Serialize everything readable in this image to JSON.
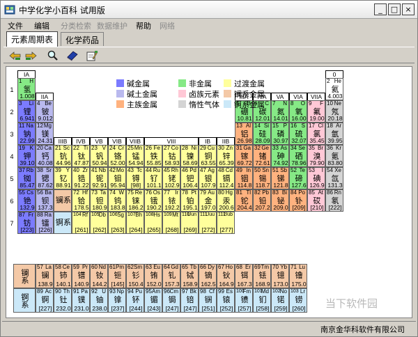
{
  "window": {
    "title": "中学化学小百科 试用版",
    "minimize": "_",
    "maximize": "□",
    "close": "×"
  },
  "menu": [
    {
      "label": "文件",
      "disabled": false
    },
    {
      "label": "编辑",
      "disabled": false
    },
    {
      "label": "分类检索",
      "disabled": true
    },
    {
      "label": "数据维护",
      "disabled": true
    },
    {
      "label": "帮助",
      "disabled": false
    },
    {
      "label": "网络",
      "disabled": true
    }
  ],
  "tabs": [
    {
      "label": "元素周期表",
      "active": true
    },
    {
      "label": "化学药品",
      "active": false
    }
  ],
  "toolbar_icons": [
    "back-forward-icon",
    "forward-icon",
    "search-icon",
    "book-icon",
    "edit-icon"
  ],
  "colors": {
    "alkali": "#7b7bff",
    "alkaline": "#b9b9ee",
    "main": "#ffb27f",
    "nonmetal": "#86e986",
    "halogen": "#ffc8d6",
    "noble": "#d4d4d4",
    "transition": "#ffff9c",
    "lanthanide": "#f4c9a7",
    "actinide": "#cbe8f8"
  },
  "legend": [
    {
      "key": "alkali",
      "label": "碱金属"
    },
    {
      "key": "nonmetal",
      "label": "非金属"
    },
    {
      "key": "transition",
      "label": "过渡金属"
    },
    {
      "key": "alkaline",
      "label": "碱土金属"
    },
    {
      "key": "halogen",
      "label": "卤族元素"
    },
    {
      "key": "lanthanide",
      "label": "镧系金属"
    },
    {
      "key": "main",
      "label": "主族金属"
    },
    {
      "key": "noble",
      "label": "惰性气体"
    },
    {
      "key": "actinide",
      "label": "锕系金属"
    }
  ],
  "group_headers": [
    "IA",
    "IIA",
    "IIIB",
    "IVB",
    "VB",
    "VIB",
    "VIIB",
    "VIII",
    "IB",
    "IIB",
    "IIIA",
    "IVA",
    "VA",
    "VIA",
    "VIIA",
    "0"
  ],
  "periods": [
    "1",
    "2",
    "3",
    "4",
    "5",
    "6",
    "7"
  ],
  "series_labels": {
    "lanthanide_block": "镧系",
    "actinide_block": "锕系",
    "lanthanide_row": "镧系",
    "actinide_row": "锕系"
  },
  "elements": [
    {
      "n": "1",
      "s": "H",
      "cn": "氢",
      "m": "1.008",
      "c": "nonmetal"
    },
    {
      "n": "2",
      "s": "He",
      "cn": "氦",
      "m": "4.003",
      "c": "white"
    },
    {
      "n": "3",
      "s": "Li",
      "cn": "锂",
      "m": "6.941",
      "c": "alkali"
    },
    {
      "n": "4",
      "s": "Be",
      "cn": "铍",
      "m": "9.012",
      "c": "alkaline"
    },
    {
      "n": "5",
      "s": "B",
      "cn": "硼",
      "m": "10.81",
      "c": "nonmetal"
    },
    {
      "n": "6",
      "s": "C",
      "cn": "碳",
      "m": "12.01",
      "c": "nonmetal"
    },
    {
      "n": "7",
      "s": "N",
      "cn": "氮",
      "m": "14.01",
      "c": "nonmetal"
    },
    {
      "n": "8",
      "s": "O",
      "cn": "氧",
      "m": "16.00",
      "c": "nonmetal"
    },
    {
      "n": "9",
      "s": "F",
      "cn": "氟",
      "m": "19.00",
      "c": "halogen"
    },
    {
      "n": "10",
      "s": "Ne",
      "cn": "氖",
      "m": "20.18",
      "c": "noble"
    },
    {
      "n": "11",
      "s": "Na",
      "cn": "钠",
      "m": "22.99",
      "c": "alkali"
    },
    {
      "n": "12",
      "s": "Mg",
      "cn": "镁",
      "m": "24.31",
      "c": "alkaline"
    },
    {
      "n": "13",
      "s": "Al",
      "cn": "铝",
      "m": "26.98",
      "c": "main"
    },
    {
      "n": "14",
      "s": "Si",
      "cn": "硅",
      "m": "28.09",
      "c": "nonmetal"
    },
    {
      "n": "15",
      "s": "P",
      "cn": "磷",
      "m": "30.97",
      "c": "nonmetal"
    },
    {
      "n": "16",
      "s": "S",
      "cn": "硫",
      "m": "32.07",
      "c": "nonmetal"
    },
    {
      "n": "17",
      "s": "Cl",
      "cn": "氯",
      "m": "35.45",
      "c": "halogen"
    },
    {
      "n": "18",
      "s": "Ar",
      "cn": "氩",
      "m": "39.95",
      "c": "noble"
    },
    {
      "n": "19",
      "s": "K",
      "cn": "钾",
      "m": "39.10",
      "c": "alkali"
    },
    {
      "n": "20",
      "s": "Ca",
      "cn": "钙",
      "m": "40.08",
      "c": "alkaline"
    },
    {
      "n": "21",
      "s": "Sc",
      "cn": "钪",
      "m": "44.96",
      "c": "transition"
    },
    {
      "n": "22",
      "s": "Ti",
      "cn": "钛",
      "m": "47.87",
      "c": "transition"
    },
    {
      "n": "23",
      "s": "V",
      "cn": "钒",
      "m": "50.94",
      "c": "transition"
    },
    {
      "n": "24",
      "s": "Cr",
      "cn": "铬",
      "m": "52.00",
      "c": "transition"
    },
    {
      "n": "25",
      "s": "Mn",
      "cn": "锰",
      "m": "54.94",
      "c": "transition"
    },
    {
      "n": "26",
      "s": "Fe",
      "cn": "铁",
      "m": "55.85",
      "c": "transition"
    },
    {
      "n": "27",
      "s": "Co",
      "cn": "钴",
      "m": "58.93",
      "c": "transition"
    },
    {
      "n": "28",
      "s": "Ni",
      "cn": "镍",
      "m": "58.69",
      "c": "transition"
    },
    {
      "n": "29",
      "s": "Cu",
      "cn": "铜",
      "m": "63.55",
      "c": "transition"
    },
    {
      "n": "30",
      "s": "Zn",
      "cn": "锌",
      "m": "65.39",
      "c": "transition"
    },
    {
      "n": "31",
      "s": "Ga",
      "cn": "镓",
      "m": "69.72",
      "c": "main"
    },
    {
      "n": "32",
      "s": "Ge",
      "cn": "锗",
      "m": "72.61",
      "c": "main"
    },
    {
      "n": "33",
      "s": "As",
      "cn": "砷",
      "m": "74.92",
      "c": "nonmetal"
    },
    {
      "n": "34",
      "s": "Se",
      "cn": "硒",
      "m": "78.96",
      "c": "nonmetal"
    },
    {
      "n": "35",
      "s": "Br",
      "cn": "溴",
      "m": "79.90",
      "c": "halogen"
    },
    {
      "n": "36",
      "s": "Kr",
      "cn": "氪",
      "m": "83.80",
      "c": "noble"
    },
    {
      "n": "37",
      "s": "Rb",
      "cn": "铷",
      "m": "85.47",
      "c": "alkali"
    },
    {
      "n": "38",
      "s": "Sr",
      "cn": "锶",
      "m": "87.62",
      "c": "alkaline"
    },
    {
      "n": "39",
      "s": "Y",
      "cn": "钇",
      "m": "88.91",
      "c": "transition"
    },
    {
      "n": "40",
      "s": "Zr",
      "cn": "锆",
      "m": "91.22",
      "c": "transition"
    },
    {
      "n": "41",
      "s": "Nb",
      "cn": "铌",
      "m": "92.91",
      "c": "transition"
    },
    {
      "n": "42",
      "s": "Mo",
      "cn": "钼",
      "m": "95.94",
      "c": "transition"
    },
    {
      "n": "43",
      "s": "Tc",
      "cn": "锝",
      "m": "[98]",
      "c": "transition"
    },
    {
      "n": "44",
      "s": "Ru",
      "cn": "钌",
      "m": "101.1",
      "c": "transition"
    },
    {
      "n": "45",
      "s": "Rh",
      "cn": "铑",
      "m": "102.9",
      "c": "transition"
    },
    {
      "n": "46",
      "s": "Pd",
      "cn": "钯",
      "m": "106.4",
      "c": "transition"
    },
    {
      "n": "47",
      "s": "Ag",
      "cn": "银",
      "m": "107.9",
      "c": "transition"
    },
    {
      "n": "48",
      "s": "Cd",
      "cn": "镉",
      "m": "112.4",
      "c": "transition"
    },
    {
      "n": "49",
      "s": "In",
      "cn": "铟",
      "m": "114.8",
      "c": "main"
    },
    {
      "n": "50",
      "s": "Sn",
      "cn": "锡",
      "m": "118.7",
      "c": "main"
    },
    {
      "n": "51",
      "s": "Sb",
      "cn": "锑",
      "m": "121.8",
      "c": "main"
    },
    {
      "n": "52",
      "s": "Te",
      "cn": "碲",
      "m": "127.6",
      "c": "nonmetal"
    },
    {
      "n": "53",
      "s": "I",
      "cn": "碘",
      "m": "126.9",
      "c": "halogen"
    },
    {
      "n": "54",
      "s": "Xe",
      "cn": "氙",
      "m": "131.3",
      "c": "noble"
    },
    {
      "n": "55",
      "s": "Cs",
      "cn": "铯",
      "m": "132.9",
      "c": "alkali"
    },
    {
      "n": "56",
      "s": "Ba",
      "cn": "钡",
      "m": "137.3",
      "c": "alkaline"
    },
    {
      "n": "72",
      "s": "Hf",
      "cn": "铪",
      "m": "178.5",
      "c": "transition"
    },
    {
      "n": "73",
      "s": "Ta",
      "cn": "钽",
      "m": "180.9",
      "c": "transition"
    },
    {
      "n": "74",
      "s": "W",
      "cn": "钨",
      "m": "183.8",
      "c": "transition"
    },
    {
      "n": "75",
      "s": "Re",
      "cn": "铼",
      "m": "186.2",
      "c": "transition"
    },
    {
      "n": "76",
      "s": "Os",
      "cn": "锇",
      "m": "190.2",
      "c": "transition"
    },
    {
      "n": "77",
      "s": "Ir",
      "cn": "铱",
      "m": "192.2",
      "c": "transition"
    },
    {
      "n": "78",
      "s": "Pt",
      "cn": "铂",
      "m": "195.1",
      "c": "transition"
    },
    {
      "n": "79",
      "s": "Au",
      "cn": "金",
      "m": "197.0",
      "c": "transition"
    },
    {
      "n": "80",
      "s": "Hg",
      "cn": "汞",
      "m": "200.6",
      "c": "transition"
    },
    {
      "n": "81",
      "s": "Tl",
      "cn": "铊",
      "m": "204.4",
      "c": "main"
    },
    {
      "n": "82",
      "s": "Pb",
      "cn": "铅",
      "m": "207.2",
      "c": "main"
    },
    {
      "n": "83",
      "s": "Bi",
      "cn": "铋",
      "m": "209.0",
      "c": "main"
    },
    {
      "n": "84",
      "s": "Po",
      "cn": "钋",
      "m": "[209]",
      "c": "main"
    },
    {
      "n": "85",
      "s": "At",
      "cn": "砹",
      "m": "[210]",
      "c": "halogen"
    },
    {
      "n": "86",
      "s": "Rn",
      "cn": "氡",
      "m": "[222]",
      "c": "noble"
    },
    {
      "n": "87",
      "s": "Fr",
      "cn": "钫",
      "m": "[223]",
      "c": "alkali"
    },
    {
      "n": "88",
      "s": "Ra",
      "cn": "镭",
      "m": "[226]",
      "c": "alkaline"
    },
    {
      "n": "104",
      "s": "Rf",
      "cn": "",
      "m": "[261]",
      "c": "transition"
    },
    {
      "n": "105",
      "s": "Db",
      "cn": "",
      "m": "[262]",
      "c": "transition"
    },
    {
      "n": "106",
      "s": "Sg",
      "cn": "",
      "m": "[263]",
      "c": "transition"
    },
    {
      "n": "107",
      "s": "Bh",
      "cn": "",
      "m": "[264]",
      "c": "transition"
    },
    {
      "n": "108",
      "s": "Hs",
      "cn": "",
      "m": "[265]",
      "c": "transition"
    },
    {
      "n": "109",
      "s": "Mt",
      "cn": "",
      "m": "[268]",
      "c": "transition"
    },
    {
      "n": "110",
      "s": "Uun",
      "cn": "",
      "m": "[269]",
      "c": "transition"
    },
    {
      "n": "111",
      "s": "Uuu",
      "cn": "",
      "m": "[272]",
      "c": "transition"
    },
    {
      "n": "112",
      "s": "Uub",
      "cn": "",
      "m": "[277]",
      "c": "transition"
    },
    {
      "n": "57",
      "s": "La",
      "cn": "镧",
      "m": "138.9",
      "c": "lanthanide"
    },
    {
      "n": "58",
      "s": "Ce",
      "cn": "铈",
      "m": "140.1",
      "c": "lanthanide"
    },
    {
      "n": "59",
      "s": "Pr",
      "cn": "镨",
      "m": "140.9",
      "c": "lanthanide"
    },
    {
      "n": "60",
      "s": "Nd",
      "cn": "钕",
      "m": "144.2",
      "c": "lanthanide"
    },
    {
      "n": "61",
      "s": "Pm",
      "cn": "钷",
      "m": "[145]",
      "c": "lanthanide"
    },
    {
      "n": "62",
      "s": "Sm",
      "cn": "钐",
      "m": "150.4",
      "c": "lanthanide"
    },
    {
      "n": "63",
      "s": "Eu",
      "cn": "铕",
      "m": "152.0",
      "c": "lanthanide"
    },
    {
      "n": "64",
      "s": "Gd",
      "cn": "钆",
      "m": "157.3",
      "c": "lanthanide"
    },
    {
      "n": "65",
      "s": "Tb",
      "cn": "铽",
      "m": "158.9",
      "c": "lanthanide"
    },
    {
      "n": "66",
      "s": "Dy",
      "cn": "镝",
      "m": "162.5",
      "c": "lanthanide"
    },
    {
      "n": "67",
      "s": "Ho",
      "cn": "钬",
      "m": "164.9",
      "c": "lanthanide"
    },
    {
      "n": "68",
      "s": "Er",
      "cn": "铒",
      "m": "167.3",
      "c": "lanthanide"
    },
    {
      "n": "69",
      "s": "Tm",
      "cn": "铥",
      "m": "168.9",
      "c": "lanthanide"
    },
    {
      "n": "70",
      "s": "Yb",
      "cn": "镱",
      "m": "173.0",
      "c": "lanthanide"
    },
    {
      "n": "71",
      "s": "Lu",
      "cn": "镥",
      "m": "175.0",
      "c": "lanthanide"
    },
    {
      "n": "89",
      "s": "Ac",
      "cn": "锕",
      "m": "[227]",
      "c": "actinide"
    },
    {
      "n": "90",
      "s": "Th",
      "cn": "钍",
      "m": "232.0",
      "c": "actinide"
    },
    {
      "n": "91",
      "s": "Pa",
      "cn": "镤",
      "m": "231.0",
      "c": "actinide"
    },
    {
      "n": "92",
      "s": "U",
      "cn": "铀",
      "m": "238.0",
      "c": "actinide"
    },
    {
      "n": "93",
      "s": "Np",
      "cn": "镎",
      "m": "[237]",
      "c": "actinide"
    },
    {
      "n": "94",
      "s": "Pu",
      "cn": "钚",
      "m": "[244]",
      "c": "actinide"
    },
    {
      "n": "95",
      "s": "Am",
      "cn": "镅",
      "m": "[243]",
      "c": "actinide"
    },
    {
      "n": "96",
      "s": "Cm",
      "cn": "锔",
      "m": "[247]",
      "c": "actinide"
    },
    {
      "n": "97",
      "s": "Bk",
      "cn": "锫",
      "m": "[247]",
      "c": "actinide"
    },
    {
      "n": "98",
      "s": "Cf",
      "cn": "锎",
      "m": "[251]",
      "c": "actinide"
    },
    {
      "n": "99",
      "s": "Es",
      "cn": "锿",
      "m": "[252]",
      "c": "actinide"
    },
    {
      "n": "100",
      "s": "Fm",
      "cn": "镄",
      "m": "[257]",
      "c": "actinide"
    },
    {
      "n": "101",
      "s": "Md",
      "cn": "钔",
      "m": "[258]",
      "c": "actinide"
    },
    {
      "n": "102",
      "s": "No",
      "cn": "锘",
      "m": "[259]",
      "c": "actinide"
    },
    {
      "n": "103",
      "s": "Lr",
      "cn": "铹",
      "m": "[260]",
      "c": "actinide"
    }
  ],
  "status": "南京金华科软件有限公司",
  "watermark": "当下软件园"
}
